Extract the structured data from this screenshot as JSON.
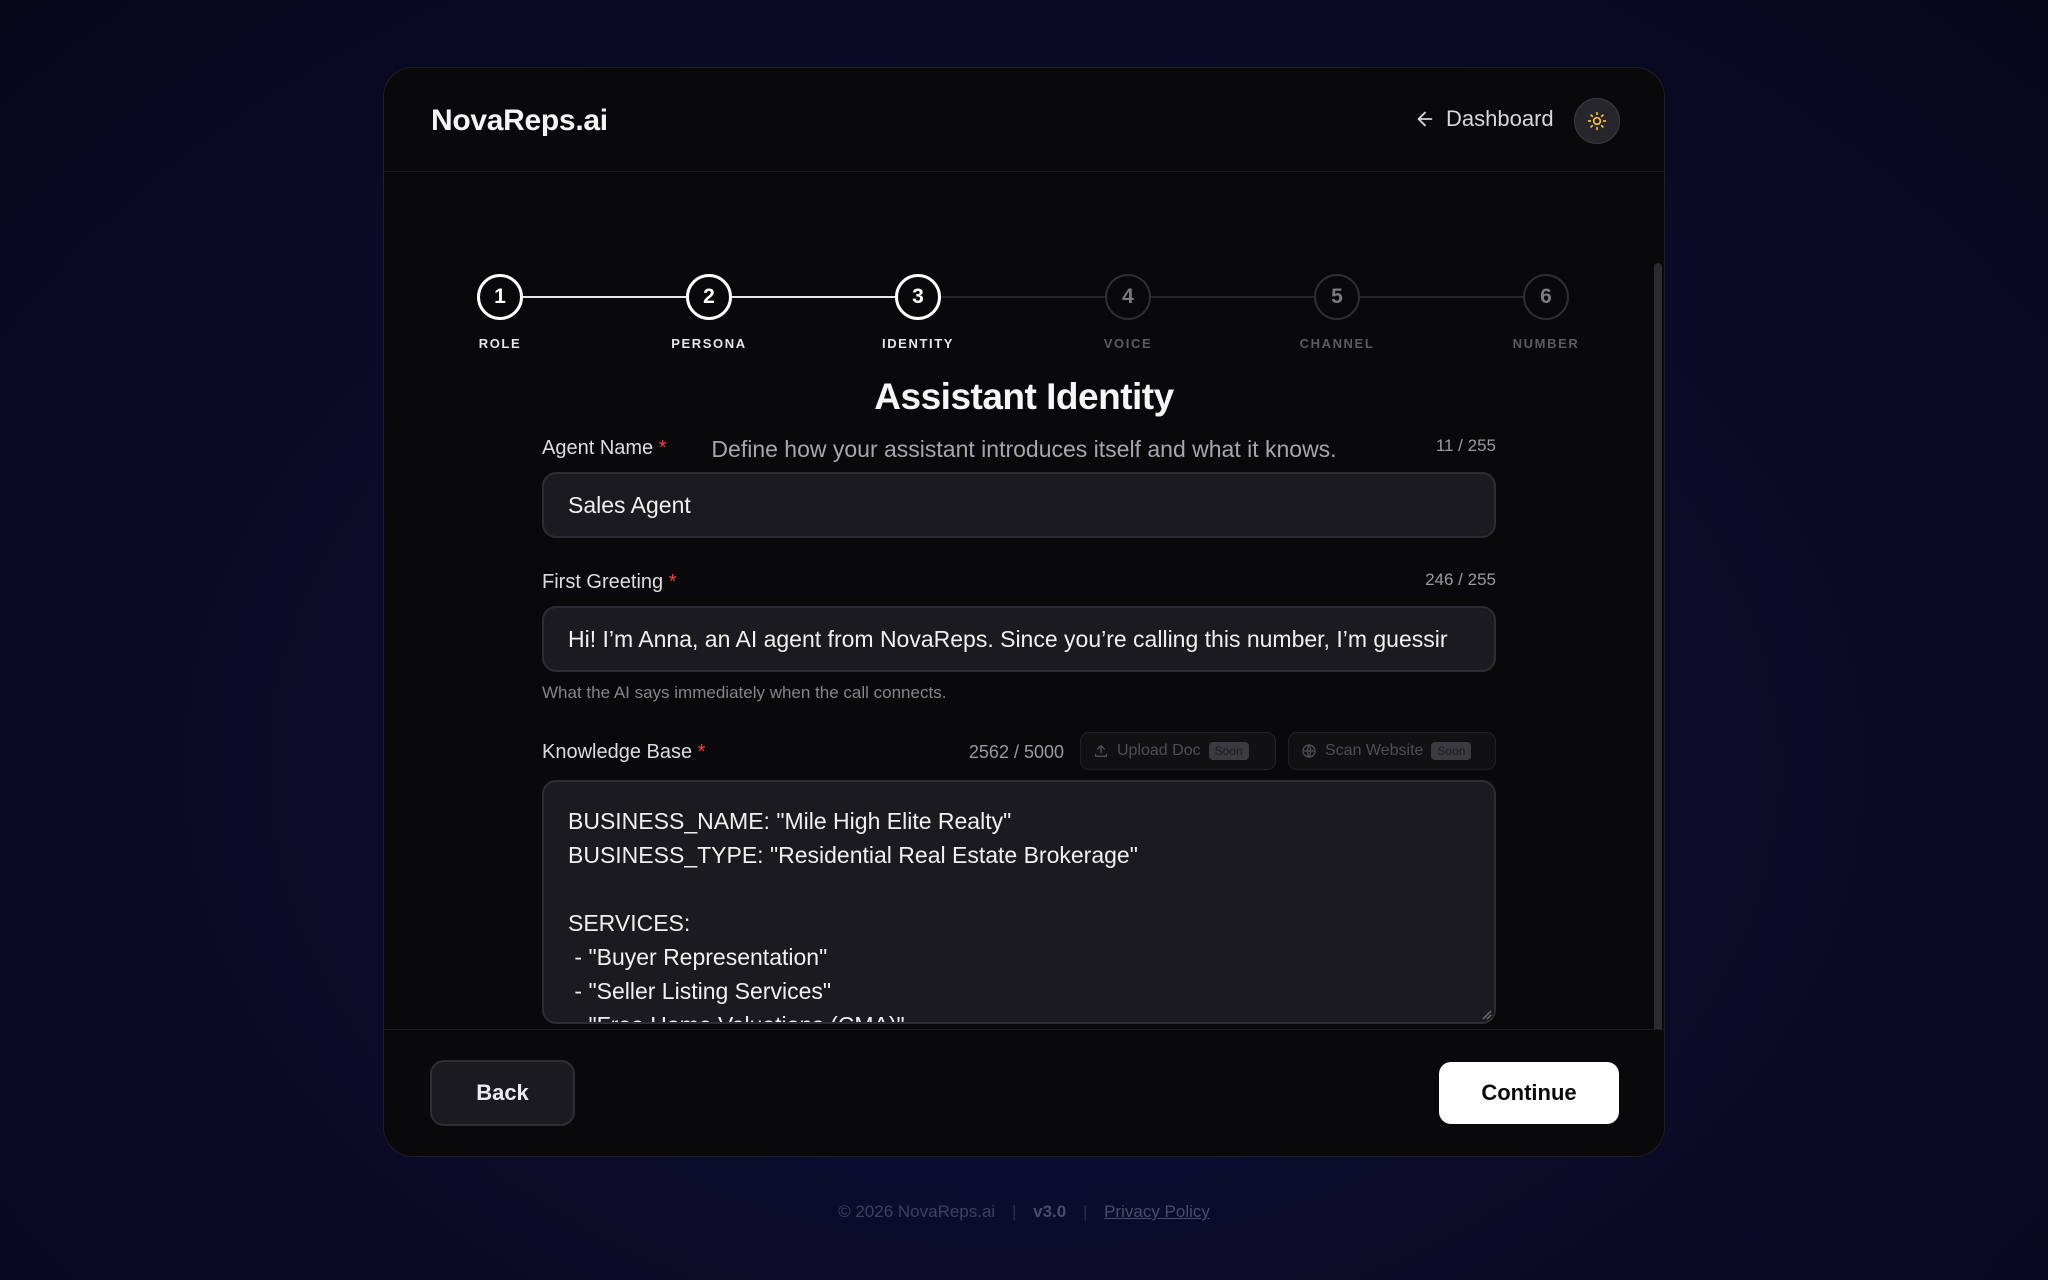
{
  "header": {
    "brand": "NovaReps.ai",
    "dashboard_label": "Dashboard",
    "theme_icon": "sun-icon",
    "back_icon": "arrow-left-icon"
  },
  "stepper": {
    "steps": [
      {
        "number": "1",
        "label": "ROLE",
        "state": "done"
      },
      {
        "number": "2",
        "label": "PERSONA",
        "state": "done"
      },
      {
        "number": "3",
        "label": "IDENTITY",
        "state": "current"
      },
      {
        "number": "4",
        "label": "VOICE",
        "state": "todo"
      },
      {
        "number": "5",
        "label": "CHANNEL",
        "state": "todo"
      },
      {
        "number": "6",
        "label": "NUMBER",
        "state": "todo"
      }
    ]
  },
  "page": {
    "title": "Assistant Identity",
    "subtitle": "Define how your assistant introduces itself and what it knows."
  },
  "agent_name": {
    "label": "Agent Name",
    "required": "*",
    "counter": "11 / 255",
    "value": "Sales Agent"
  },
  "first_greeting": {
    "label": "First Greeting",
    "required": "*",
    "counter": "246 / 255",
    "value": "Hi! I’m Anna, an AI agent from NovaReps. Since you’re calling this number, I’m guessir",
    "helper": "What the AI says immediately when the call connects."
  },
  "knowledge_base": {
    "label": "Knowledge Base",
    "required": "*",
    "counter": "2562 / 5000",
    "upload_label": "Upload Doc",
    "upload_badge": "Soon",
    "upload_icon": "upload-icon",
    "scan_label": "Scan Website",
    "scan_badge": "Soon",
    "scan_icon": "globe-icon",
    "value": "BUSINESS_NAME: \"Mile High Elite Realty\"\nBUSINESS_TYPE: \"Residential Real Estate Brokerage\"\n\nSERVICES:\n - \"Buyer Representation\"\n - \"Seller Listing Services\"\n - \"Free Home Valuations (CMA)\""
  },
  "actions": {
    "back_label": "Back",
    "continue_label": "Continue"
  },
  "footer": {
    "copyright": "© 2026 NovaReps.ai",
    "version": "v3.0",
    "privacy": "Privacy Policy"
  },
  "colors": {
    "background": "#0a0c2a",
    "card": "#09090b",
    "input": "#1b1b1f",
    "required": "#ef4444",
    "accent_sun": "#f5c542",
    "primary_button": "#ffffff"
  }
}
